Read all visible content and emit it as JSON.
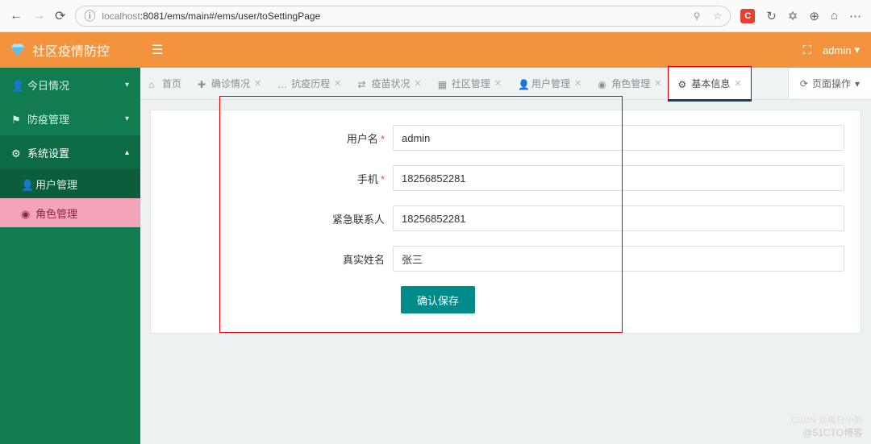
{
  "browser": {
    "url_host": "localhost",
    "url_port_path": ":8081/ems/main#/ems/user/toSettingPage",
    "red_badge": "C"
  },
  "app_title": "社区疫情防控",
  "topbar": {
    "user": "admin"
  },
  "sidebar": {
    "items": [
      {
        "label": "今日情况",
        "icon": "user-icon"
      },
      {
        "label": "防疫管理",
        "icon": "flag-icon"
      },
      {
        "label": "系统设置",
        "icon": "gears-icon",
        "expanded": true
      }
    ],
    "subitems": [
      {
        "label": "用户管理",
        "icon": "user-icon"
      },
      {
        "label": "角色管理",
        "icon": "dashboard-icon",
        "active": true
      }
    ]
  },
  "tabs": [
    {
      "label": "首页",
      "icon": "home-icon",
      "closable": false
    },
    {
      "label": "确诊情况",
      "icon": "medkit-icon",
      "closable": true
    },
    {
      "label": "抗疫历程",
      "icon": "route-icon",
      "closable": true
    },
    {
      "label": "疫苗状况",
      "icon": "vial-icon",
      "closable": true
    },
    {
      "label": "社区管理",
      "icon": "building-icon",
      "closable": true
    },
    {
      "label": "用户管理",
      "icon": "user-icon",
      "closable": true
    },
    {
      "label": "角色管理",
      "icon": "dashboard-icon",
      "closable": true
    },
    {
      "label": "基本信息",
      "icon": "gears-icon",
      "closable": true,
      "active": true
    }
  ],
  "page_ops": "页面操作",
  "form": {
    "fields": [
      {
        "label": "用户名",
        "required": true,
        "value": "admin",
        "name": "username"
      },
      {
        "label": "手机",
        "required": true,
        "value": "18256852281",
        "name": "phone"
      },
      {
        "label": "紧急联系人",
        "required": false,
        "value": "18256852281",
        "name": "emergency"
      },
      {
        "label": "真实姓名",
        "required": false,
        "value": "张三",
        "name": "realname"
      }
    ],
    "submit_label": "确认保存"
  },
  "watermark": "@51CTO博客",
  "csdn": "CSDN @每日小新"
}
